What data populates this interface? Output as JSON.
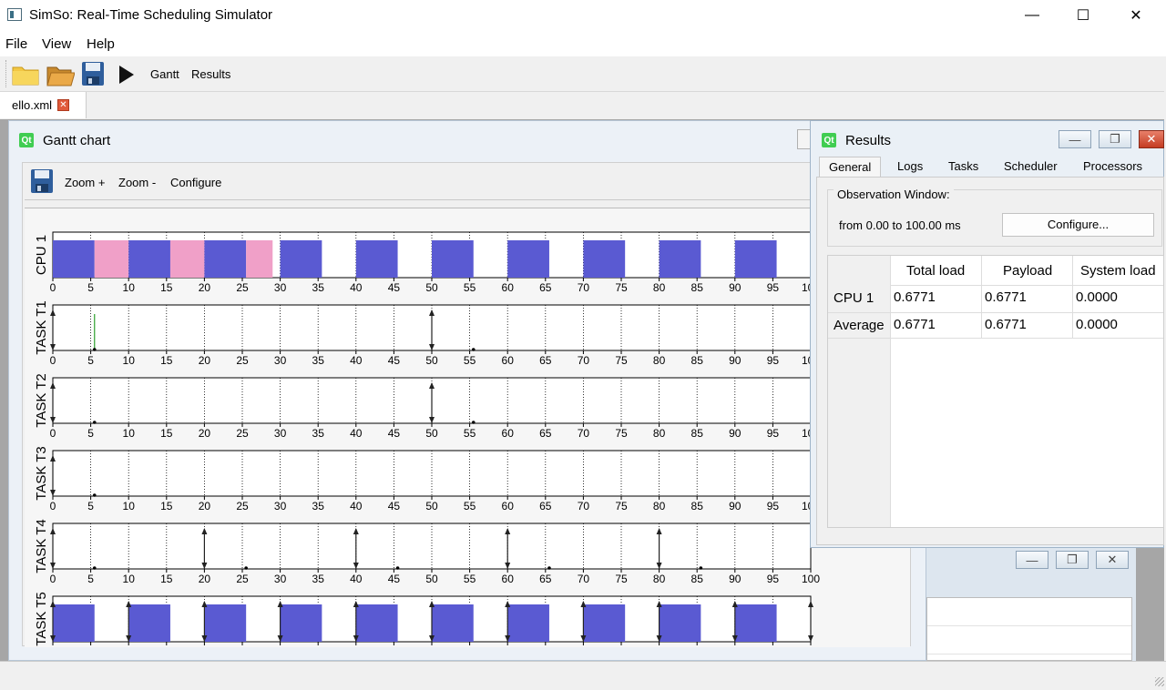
{
  "window": {
    "title": "SimSo: Real-Time Scheduling Simulator"
  },
  "menu": [
    "File",
    "View",
    "Help"
  ],
  "toolbar": {
    "gantt_label": "Gantt",
    "results_label": "Results"
  },
  "tab": {
    "name": "ello.xml"
  },
  "gantt": {
    "title": "Gantt chart",
    "zoom_in": "Zoom +",
    "zoom_out": "Zoom -",
    "configure": "Configure",
    "ticks": [
      "0",
      "5",
      "10",
      "15",
      "20",
      "25",
      "30",
      "35",
      "40",
      "45",
      "50",
      "55",
      "60",
      "65",
      "70",
      "75",
      "80",
      "85",
      "90",
      "95",
      "100"
    ],
    "colors": {
      "job": "#5a5ad2",
      "overhead": "#f0a0c8",
      "green": "#2ca02c"
    },
    "rows": [
      {
        "label": "CPU 1",
        "blocks": [
          [
            0,
            5.5,
            "job"
          ],
          [
            5.5,
            10,
            "overhead"
          ],
          [
            10,
            15.5,
            "job"
          ],
          [
            15.5,
            20,
            "overhead"
          ],
          [
            20,
            25.5,
            "job"
          ],
          [
            25.5,
            29,
            "overhead"
          ],
          [
            30,
            35.5,
            "job"
          ],
          [
            40,
            45.5,
            "job"
          ],
          [
            50,
            55.5,
            "job"
          ],
          [
            60,
            65.5,
            "job"
          ],
          [
            70,
            75.5,
            "job"
          ],
          [
            80,
            85.5,
            "job"
          ],
          [
            90,
            95.5,
            "job"
          ]
        ],
        "arrows": [],
        "dots": []
      },
      {
        "label": "TASK T1",
        "blocks": [],
        "arrows": [
          0,
          50
        ],
        "dots": [
          5.5,
          55.5
        ],
        "green": [
          5.5
        ]
      },
      {
        "label": "TASK T2",
        "blocks": [],
        "arrows": [
          0,
          50
        ],
        "dots": [
          5.5,
          55.5
        ]
      },
      {
        "label": "TASK T3",
        "blocks": [],
        "arrows": [
          0
        ],
        "dots": [
          5.5
        ]
      },
      {
        "label": "TASK T4",
        "blocks": [],
        "arrows": [
          0,
          20,
          40,
          60,
          80
        ],
        "dots": [
          5.5,
          25.5,
          45.5,
          65.5,
          85.5
        ]
      },
      {
        "label": "TASK T5",
        "blocks": [
          [
            0,
            5.5,
            "job"
          ],
          [
            10,
            15.5,
            "job"
          ],
          [
            20,
            25.5,
            "job"
          ],
          [
            30,
            35.5,
            "job"
          ],
          [
            40,
            45.5,
            "job"
          ],
          [
            50,
            55.5,
            "job"
          ],
          [
            60,
            65.5,
            "job"
          ],
          [
            70,
            75.5,
            "job"
          ],
          [
            80,
            85.5,
            "job"
          ],
          [
            90,
            95.5,
            "job"
          ]
        ],
        "arrows": [
          0,
          10,
          20,
          30,
          40,
          50,
          60,
          70,
          80,
          90,
          100
        ],
        "dots": []
      }
    ]
  },
  "results": {
    "title": "Results",
    "tabs": [
      "General",
      "Logs",
      "Tasks",
      "Scheduler",
      "Processors"
    ],
    "observation_label": "Observation Window:",
    "observation_value": "from 0.00 to 100.00 ms",
    "configure": "Configure...",
    "columns": [
      "Total load",
      "Payload",
      "System load"
    ],
    "rows": [
      {
        "name": "CPU 1",
        "values": [
          "0.6771",
          "0.6771",
          "0.0000"
        ]
      },
      {
        "name": "Average",
        "values": [
          "0.6771",
          "0.6771",
          "0.0000"
        ]
      }
    ]
  }
}
